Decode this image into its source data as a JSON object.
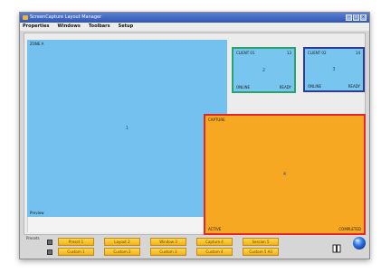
{
  "window": {
    "title": "ScreenCapture Layout Manager"
  },
  "menu": [
    "Properties",
    "Windows",
    "Toolbars",
    "Setup"
  ],
  "panels": {
    "big_blue": {
      "top_left": "ZONE A",
      "center": "1",
      "bottom_left": "Preview"
    },
    "green": {
      "top_left": "CLIENT 01",
      "top_right": "13",
      "center": "2",
      "bottom_left": "ONLINE",
      "bottom_right": "READY"
    },
    "navy": {
      "top_left": "CLIENT 02",
      "top_right": "14",
      "center": "3",
      "bottom_left": "ONLINE",
      "bottom_right": "READY"
    },
    "orange": {
      "top_left": "CAPTURE",
      "center": "4",
      "bottom_left": "ACTIVE",
      "bottom_right": "COMPLETED"
    }
  },
  "bottom": {
    "label": "Presets",
    "row1": [
      "Preset 1",
      "Layout 2",
      "Window 3",
      "Capture 4",
      "Session 5"
    ],
    "row2": [
      "Custom 1",
      "Custom 2",
      "Custom 3",
      "Custom 4",
      "Custom 5 All"
    ]
  },
  "colors": {
    "light_blue": "#74c0ee",
    "green_border": "#29a36c",
    "navy_border": "#2d3d95",
    "orange_fill": "#f7a823",
    "red_border": "#e4262a",
    "button_yellow": "#f0b219"
  }
}
